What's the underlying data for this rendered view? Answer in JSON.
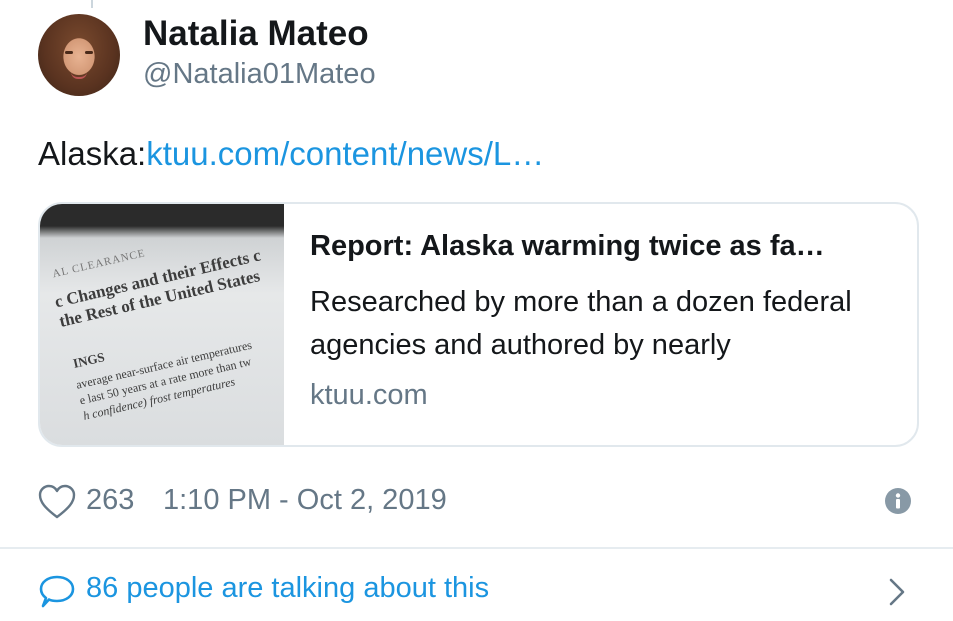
{
  "author": {
    "name": "Natalia Mateo",
    "handle": "@Natalia01Mateo",
    "avatar_icon": "profile-photo"
  },
  "tweet": {
    "text_prefix": "Alaska:",
    "link_text": "ktuu.com/content/news/L…"
  },
  "card": {
    "title": "Report: Alaska warming twice as fa…",
    "description": "Researched by more than a dozen federal agencies and authored by nearly",
    "domain": "ktuu.com",
    "thumbnail_text": {
      "line1": "AL CLEARANCE",
      "line2": "c Changes and their Effects c",
      "line3": "the Rest of the United States",
      "line4": "INGS",
      "line5": "average near-surface air temperatures",
      "line6": "e last 50 years at a rate more than tw",
      "line7": "h confidence)    frost temperatures"
    }
  },
  "meta": {
    "like_count": "263",
    "timestamp": "1:10 PM - Oct 2, 2019",
    "heart_icon": "heart-outline",
    "info_icon": "info-circle"
  },
  "conversation": {
    "label": "86 people are talking about this",
    "bubble_icon": "speech-bubble",
    "chevron_icon": "chevron-right"
  },
  "colors": {
    "link": "#1b95e0",
    "secondary_text": "#657786",
    "border": "#e1e8ed"
  }
}
